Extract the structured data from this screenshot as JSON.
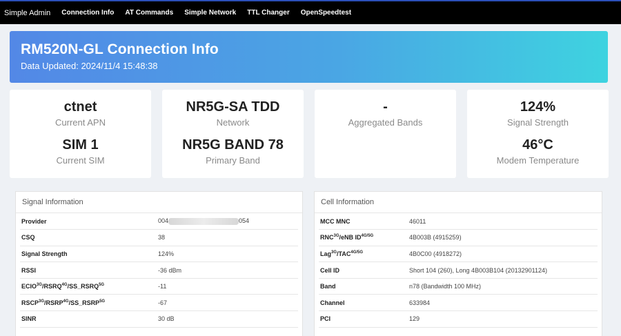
{
  "nav": {
    "brand": "Simple Admin",
    "items": [
      "Connection Info",
      "AT Commands",
      "Simple Network",
      "TTL Changer",
      "OpenSpeedtest"
    ]
  },
  "banner": {
    "title": "RM520N-GL Connection Info",
    "updated": "Data Updated: 2024/11/4 15:48:38"
  },
  "cards": [
    {
      "v1": "ctnet",
      "l1": "Current APN",
      "v2": "SIM 1",
      "l2": "Current SIM"
    },
    {
      "v1": "NR5G-SA TDD",
      "l1": "Network",
      "v2": "NR5G BAND 78",
      "l2": "Primary Band"
    },
    {
      "v1": "-",
      "l1": "Aggregated Bands",
      "v2": "",
      "l2": ""
    },
    {
      "v1": "124%",
      "l1": "Signal Strength",
      "v2": "46°C",
      "l2": "Modem Temperature"
    }
  ],
  "signal": {
    "title": "Signal Information",
    "rows": [
      {
        "k": "Provider",
        "v_prefix": "004",
        "v_suffix": "054"
      },
      {
        "k": "CSQ",
        "v": "38"
      },
      {
        "k": "Signal Strength",
        "v": "124%"
      },
      {
        "k": "RSSI",
        "v": "-36 dBm"
      },
      {
        "k_a": "ECIO",
        "k_a_sup": "3G",
        "k_b": "/RSRQ",
        "k_b_sup": "4G",
        "k_c": "/SS_RSRQ",
        "k_c_sup": "5G",
        "v": "-11"
      },
      {
        "k_a": "RSCP",
        "k_a_sup": "3G",
        "k_b": "/RSRP",
        "k_b_sup": "4G",
        "k_c": "/SS_RSRP",
        "k_c_sup": "5G",
        "v": "-67"
      },
      {
        "k": "SINR",
        "v": "30 dB"
      }
    ]
  },
  "cell": {
    "title": "Cell Information",
    "rows": [
      {
        "k": "MCC MNC",
        "v": "46011"
      },
      {
        "k_a": "RNC",
        "k_a_sup": "3G",
        "k_b": "/eNB ID",
        "k_b_sup": "4G/5G",
        "v": "4B003B (4915259)"
      },
      {
        "k_a": "Lag",
        "k_a_sup": "3G",
        "k_b": "/TAC",
        "k_b_sup": "4G/5G",
        "v": "4B0C00 (4918272)"
      },
      {
        "k": "Cell ID",
        "v": "Short 104 (260), Long 4B003B104 (20132901124)"
      },
      {
        "k": "Band",
        "v": "n78 (Bandwidth 100 MHz)"
      },
      {
        "k": "Channel",
        "v": "633984"
      },
      {
        "k": "PCI",
        "v": "129"
      }
    ]
  }
}
